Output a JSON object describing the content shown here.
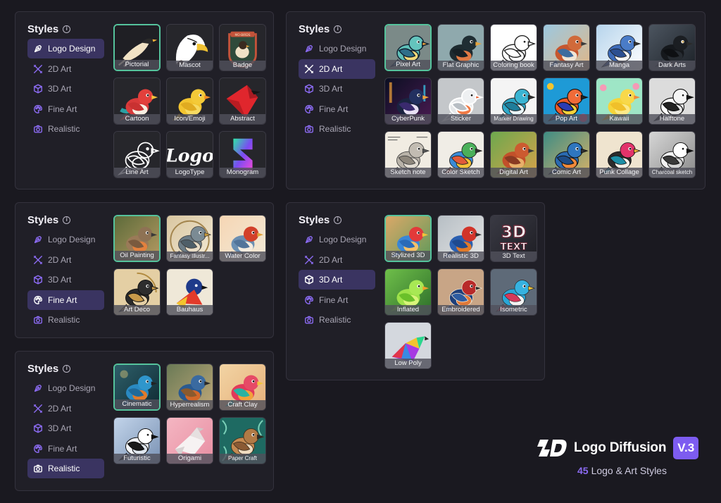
{
  "panels": [
    {
      "id": "logo",
      "title": "Styles",
      "active": 0,
      "menu": [
        "Logo Design",
        "2D Art",
        "3D Art",
        "Fine Art",
        "Realistic"
      ],
      "tiles": [
        {
          "label": "Pictorial",
          "art": "pictorial",
          "selected": true
        },
        {
          "label": "Mascot",
          "art": "mascot"
        },
        {
          "label": "Badge",
          "art": "badge"
        },
        {
          "label": "Cartoon",
          "art": "cartoon"
        },
        {
          "label": "Icon/Emoji",
          "art": "emoji"
        },
        {
          "label": "Abstract",
          "art": "abstract"
        },
        {
          "label": "Line Art",
          "art": "lineart"
        },
        {
          "label": "LogoType",
          "art": "logotype"
        },
        {
          "label": "Monogram",
          "art": "monogram"
        }
      ]
    },
    {
      "id": "2d",
      "title": "Styles",
      "active": 1,
      "menu": [
        "Logo Design",
        "2D Art",
        "3D Art",
        "Fine Art",
        "Realistic"
      ],
      "tiles": [
        {
          "label": "Pixel Art",
          "art": "pixel",
          "selected": true
        },
        {
          "label": "Flat Graphic",
          "art": "flat"
        },
        {
          "label": "Coloring book",
          "art": "coloring"
        },
        {
          "label": "Fantasy Art",
          "art": "fantasy"
        },
        {
          "label": "Manga",
          "art": "manga"
        },
        {
          "label": "Dark Arts",
          "art": "dark"
        },
        {
          "label": "CyberPunk",
          "art": "cyber"
        },
        {
          "label": "Sticker",
          "art": "sticker"
        },
        {
          "label": "Marker Drawing",
          "art": "marker",
          "small": true
        },
        {
          "label": "Pop Art",
          "art": "pop"
        },
        {
          "label": "Kawaii",
          "art": "kawaii"
        },
        {
          "label": "Halftone",
          "art": "halftone"
        },
        {
          "label": "Sketch note",
          "art": "sketchnote"
        },
        {
          "label": "Color Sketch",
          "art": "colorsketch"
        },
        {
          "label": "Digital Art",
          "art": "digital"
        },
        {
          "label": "Comic Art",
          "art": "comic"
        },
        {
          "label": "Punk Collage",
          "art": "punk"
        },
        {
          "label": "Charcoal sketch",
          "art": "charcoal",
          "small": true
        }
      ]
    },
    {
      "id": "fine",
      "title": "Styles",
      "active": 3,
      "menu": [
        "Logo Design",
        "2D Art",
        "3D Art",
        "Fine Art",
        "Realistic"
      ],
      "tiles": [
        {
          "label": "Oil Painting",
          "art": "oil",
          "selected": true
        },
        {
          "label": "Fantasy Illustr...",
          "art": "fantasyillus",
          "small": true
        },
        {
          "label": "Water Color",
          "art": "watercolor"
        },
        {
          "label": "Art Deco",
          "art": "artdeco"
        },
        {
          "label": "Bauhaus",
          "art": "bauhaus"
        }
      ]
    },
    {
      "id": "3d",
      "title": "Styles",
      "active": 2,
      "menu": [
        "Logo Design",
        "2D Art",
        "3D Art",
        "Fine Art",
        "Realistic"
      ],
      "tiles": [
        {
          "label": "Stylized 3D",
          "art": "stylized",
          "selected": true
        },
        {
          "label": "Realistic 3D",
          "art": "real3d"
        },
        {
          "label": "3D Text",
          "art": "text3d",
          "text": "3D TEXT"
        },
        {
          "label": "Inflated",
          "art": "inflated"
        },
        {
          "label": "Embroidered",
          "art": "embroidered"
        },
        {
          "label": "Isometric",
          "art": "isometric"
        },
        {
          "label": "Low Poly",
          "art": "lowpoly"
        }
      ]
    },
    {
      "id": "real",
      "title": "Styles",
      "active": 4,
      "menu": [
        "Logo Design",
        "2D Art",
        "3D Art",
        "Fine Art",
        "Realistic"
      ],
      "tiles": [
        {
          "label": "Cinematic",
          "art": "cinematic",
          "selected": true
        },
        {
          "label": "Hyperrealism",
          "art": "hyper"
        },
        {
          "label": "Craft Clay",
          "art": "clay"
        },
        {
          "label": "Futuristic",
          "art": "futuristic"
        },
        {
          "label": "Origami",
          "art": "origami"
        },
        {
          "label": "Paper Craft",
          "art": "papercraft",
          "small": true
        }
      ]
    }
  ],
  "menu_icons": [
    "pen-tool-icon",
    "brush-ruler-icon",
    "cube-icon",
    "palette-icon",
    "camera-icon"
  ],
  "brand": {
    "name": "Logo Diffusion",
    "version": "V.3",
    "count": "45",
    "tagline": "Logo & Art Styles"
  },
  "colors": {
    "accent": "#7d5cf0",
    "selected_border": "#55c39c",
    "active_menu": "#3a3461",
    "panel": "#201f27"
  }
}
